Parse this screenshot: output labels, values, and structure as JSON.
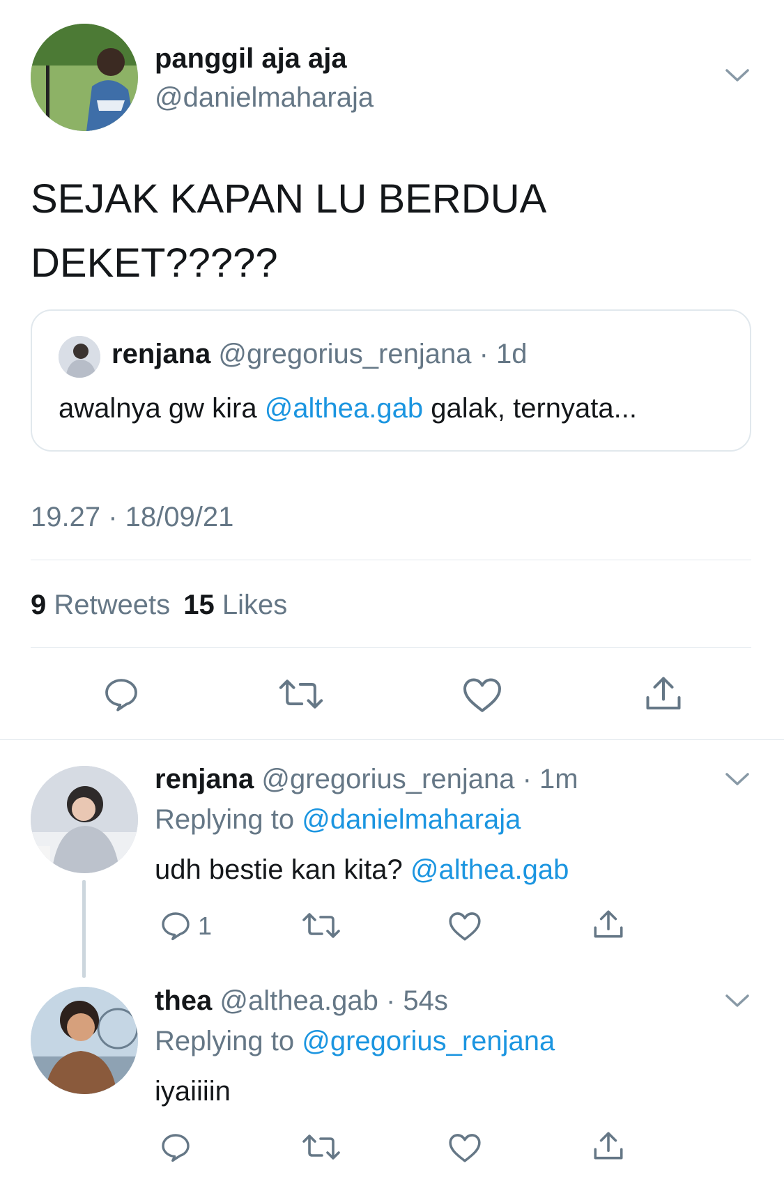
{
  "main_tweet": {
    "display_name": "panggil aja aja",
    "handle": "@danielmaharaja",
    "text_line1": "SEJAK KAPAN LU BERDUA",
    "text_line2": "DEKET?????",
    "timestamp": "19.27 · 18/09/21",
    "retweets_count": "9",
    "retweets_label": "Retweets",
    "likes_count": "15",
    "likes_label": "Likes"
  },
  "quoted_tweet": {
    "display_name": "renjana",
    "handle": "@gregorius_renjana",
    "time": "· 1d",
    "text_before": "awalnya gw kira ",
    "mention": "@althea.gab",
    "text_after": " galak, ternyata..."
  },
  "replies": [
    {
      "display_name": "renjana",
      "handle": "@gregorius_renjana",
      "time": "· 1m",
      "replying_label": "Replying to ",
      "replying_to": "@danielmaharaja",
      "text": "udh bestie kan kita? ",
      "mention": "@althea.gab",
      "reply_count": "1"
    },
    {
      "display_name": "thea",
      "handle": "@althea.gab",
      "time": "· 54s",
      "replying_label": "Replying to ",
      "replying_to": "@gregorius_renjana",
      "text": "iyaiiiin",
      "reply_count": ""
    }
  ],
  "icons": {
    "reply": "reply-icon",
    "retweet": "retweet-icon",
    "like": "heart-icon",
    "share": "share-icon",
    "more": "chevron-down-icon"
  },
  "colors": {
    "link": "#1b95e0",
    "muted": "#657786",
    "text": "#14171a",
    "divider": "#e1e8ed"
  }
}
